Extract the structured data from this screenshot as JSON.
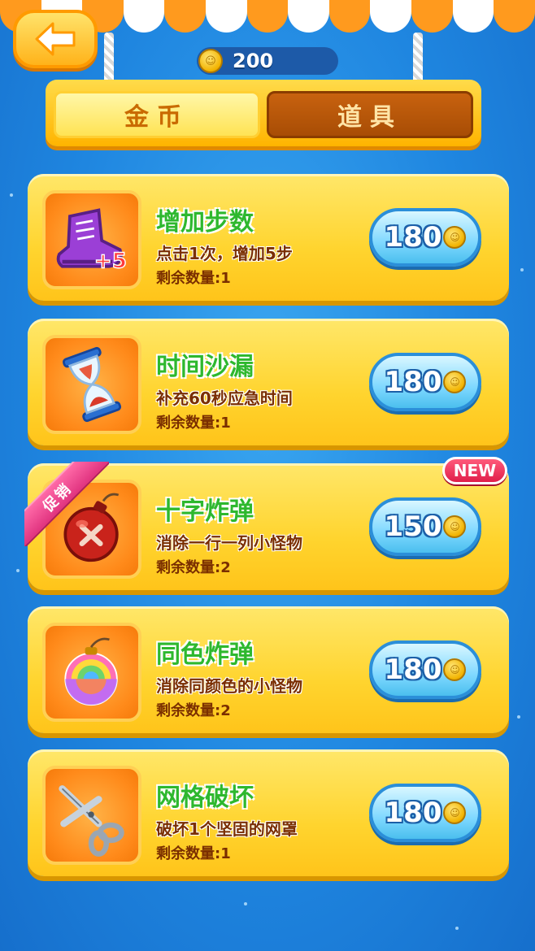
{
  "header": {
    "coins": "200"
  },
  "tabs": [
    {
      "label": "金币",
      "active": true
    },
    {
      "label": "道具",
      "active": false
    }
  ],
  "items": [
    {
      "name": "增加步数",
      "desc": "点击1次，增加5步",
      "count_label": "剩余数量:1",
      "price": "180",
      "icon": "boot-icon",
      "badge_text": "+5"
    },
    {
      "name": "时间沙漏",
      "desc": "补充60秒应急时间",
      "count_label": "剩余数量:1",
      "price": "180",
      "icon": "hourglass-icon"
    },
    {
      "name": "十字炸弹",
      "desc": "消除一行一列小怪物",
      "count_label": "剩余数量:2",
      "price": "150",
      "icon": "cross-bomb-icon",
      "promo": "促销",
      "new": "NEW"
    },
    {
      "name": "同色炸弹",
      "desc": "消除同颜色的小怪物",
      "count_label": "剩余数量:2",
      "price": "180",
      "icon": "rainbow-bomb-icon"
    },
    {
      "name": "网格破坏",
      "desc": "破坏1个坚固的网罩",
      "count_label": "剩余数量:1",
      "price": "180",
      "icon": "scissors-icon"
    }
  ],
  "colors": {
    "background": "#1f86e0",
    "card": "#ffd42e",
    "price_button": "#7fd8ff",
    "item_name": "#2eb82e"
  }
}
